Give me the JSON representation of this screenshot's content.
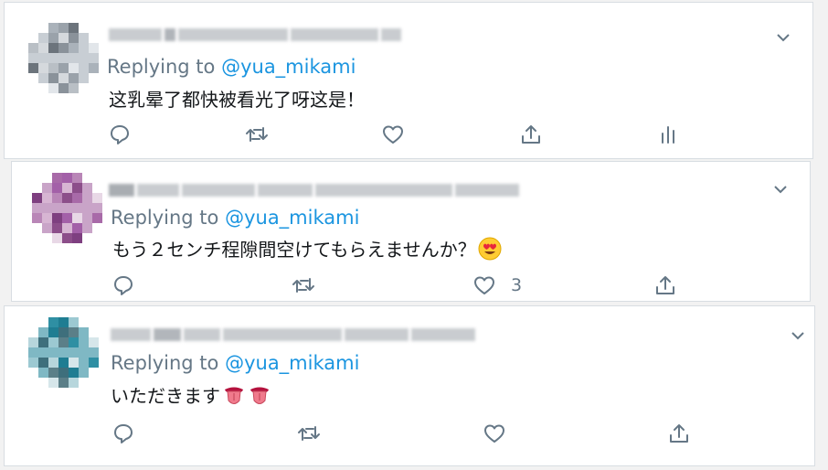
{
  "tweets": [
    {
      "reply_label": "Replying to ",
      "handle": "@yua_mikami",
      "text": "这乳晕了都快被看光了呀这是！",
      "like_count": "",
      "colors": [
        "#e2e6ea",
        "#c8ced4",
        "#aab2ba",
        "#8a929a",
        "#6c747c",
        "#d5d9dd",
        "#b9bfc5",
        "#9aa2aa"
      ]
    },
    {
      "reply_label": "Replying to ",
      "handle": "@yua_mikami",
      "text": "もう２センチ程隙間空けてもらえませんか？",
      "emoji": "heart-eyes-emoji",
      "like_count": "3",
      "colors": [
        "#e8d8e6",
        "#c9a4c8",
        "#a86aa8",
        "#8c4e8a",
        "#b986b7",
        "#d7b5d3",
        "#7e3f80",
        "#a360a8"
      ]
    },
    {
      "reply_label": "Replying to ",
      "handle": "@yua_mikami",
      "text": "いただきます",
      "emoji": "tongue-emoji",
      "like_count": "",
      "colors": [
        "#d6e6ea",
        "#7fb8c4",
        "#2f8fa3",
        "#5b7f88",
        "#9cc9d2",
        "#3e6f7c",
        "#b7d6dc",
        "#1f7d92"
      ]
    }
  ],
  "accent_color": "#1b95e0",
  "icon_color": "#657786"
}
